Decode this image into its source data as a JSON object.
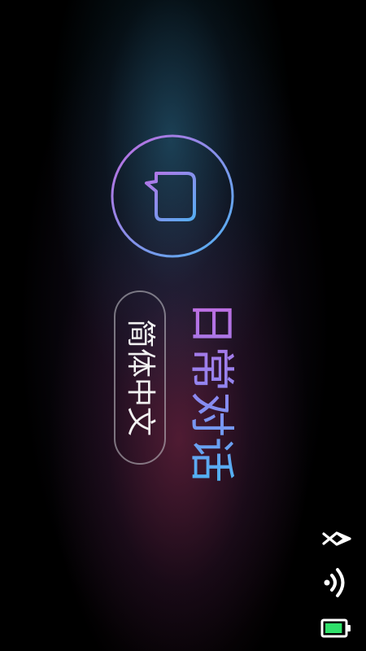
{
  "app": {
    "title": "日常对话",
    "language_button_label": "简体中文"
  },
  "icons": {
    "main": "chat-bubble-icon",
    "status": [
      "bluetooth-icon",
      "wifi-icon",
      "battery-icon"
    ]
  },
  "colors": {
    "accent_purple": "#c06ce0",
    "accent_blue": "#4fb3f2",
    "battery_fill": "#2fe06a",
    "text_primary": "#f2f2f2"
  },
  "status": {
    "battery_level": 0.85
  }
}
